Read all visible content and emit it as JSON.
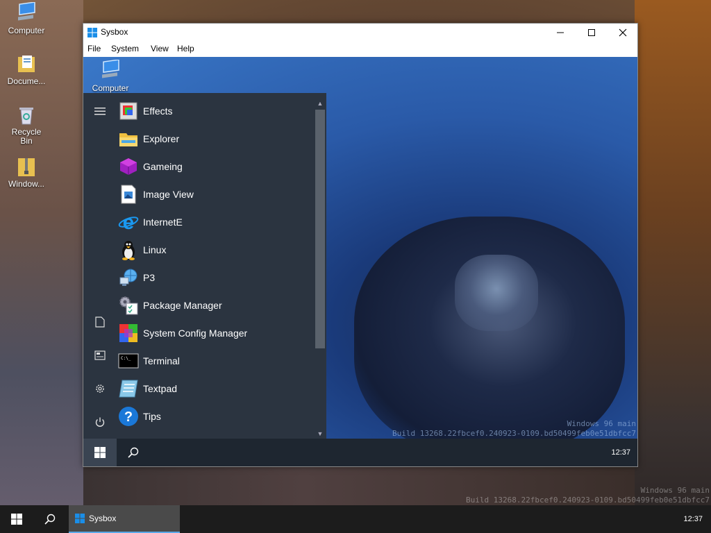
{
  "desktop": {
    "icons": [
      {
        "label": "Computer"
      },
      {
        "label": "Docume..."
      },
      {
        "label": "Recycle Bin"
      },
      {
        "label": "Window..."
      }
    ],
    "watermark": {
      "line1": "Windows 96 main",
      "line2": "Build 13268.22fbcef0.240923-0109.bd50499feb0e51dbfcc7"
    }
  },
  "taskbar": {
    "app_label": "Sysbox",
    "clock": "12:37"
  },
  "window": {
    "title": "Sysbox",
    "menu": [
      "File",
      "System",
      "View",
      "Help"
    ],
    "desktop_icon_label": "Computer",
    "watermark": {
      "line1": "Windows 96 main",
      "line2": "Build 13268.22fbcef0.240923-0109.bd50499feb0e51dbfcc7"
    },
    "start_menu": {
      "items": [
        {
          "label": "Effects",
          "icon": "effects-icon"
        },
        {
          "label": "Explorer",
          "icon": "folder-icon"
        },
        {
          "label": "Gameing",
          "icon": "game-cube-icon"
        },
        {
          "label": "Image View",
          "icon": "image-icon"
        },
        {
          "label": "InternetE",
          "icon": "internet-explorer-icon"
        },
        {
          "label": "Linux",
          "icon": "penguin-icon"
        },
        {
          "label": "P3",
          "icon": "network-globe-icon"
        },
        {
          "label": "Package Manager",
          "icon": "package-gear-icon"
        },
        {
          "label": "System Config Manager",
          "icon": "config-blocks-icon"
        },
        {
          "label": "Terminal",
          "icon": "terminal-icon"
        },
        {
          "label": "Textpad",
          "icon": "textpad-icon"
        },
        {
          "label": "Tips",
          "icon": "help-icon"
        }
      ]
    },
    "inner_clock": "12:37"
  },
  "colors": {
    "accent": "#5aa8e8",
    "menu_bg": "#2b3440",
    "taskbar": "#1c1c1c"
  }
}
